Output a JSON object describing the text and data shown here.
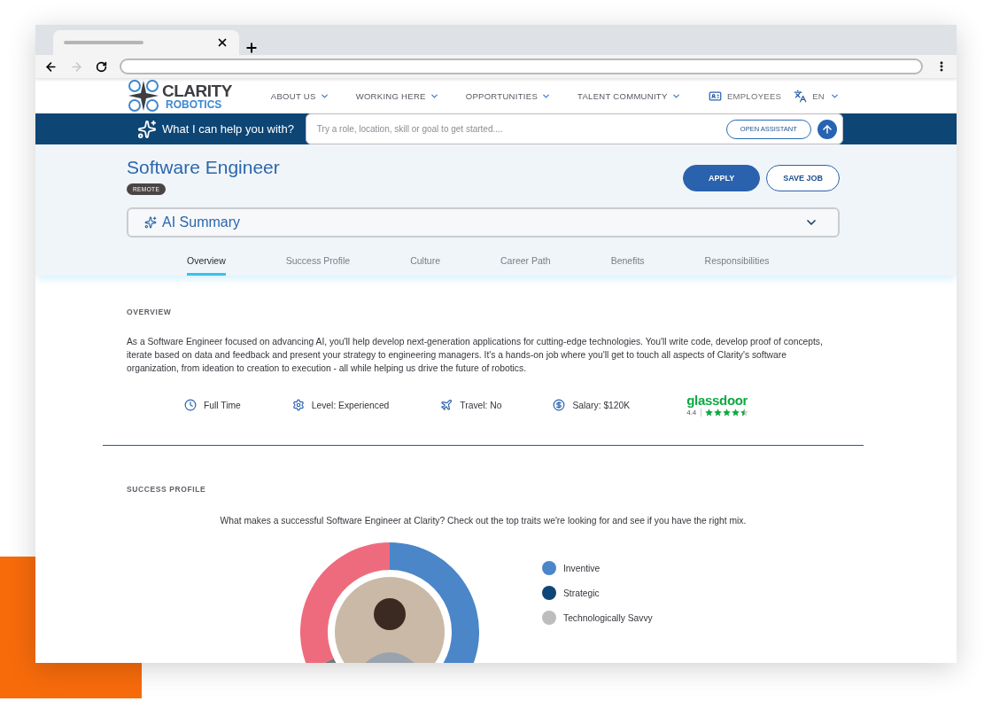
{
  "logo": {
    "line_1": "CLARITY",
    "line_2": "ROBOTICS"
  },
  "nav": [
    {
      "label": "ABOUT US"
    },
    {
      "label": "WORKING HERE"
    },
    {
      "label": "OPPORTUNITIES"
    },
    {
      "label": "TALENT COMMUNITY"
    }
  ],
  "utility": {
    "employees": "EMPLOYEES",
    "language": "EN"
  },
  "assistant": {
    "prompt": "What I can help you with?",
    "placeholder": "Try a role, location, skill or goal to get started....",
    "button": "OPEN ASSISTANT"
  },
  "job": {
    "title": "Software Engineer",
    "badge": "REMOTE",
    "buttons": [
      {
        "label": "APPLY",
        "kind": "primary"
      },
      {
        "label": "SAVE JOB",
        "kind": "secondary"
      }
    ]
  },
  "ai_summary": {
    "label": "AI Summary",
    "expanded": false
  },
  "tabs": [
    {
      "label": "Overview",
      "selected": true
    },
    {
      "label": "Success Profile",
      "selected": false
    },
    {
      "label": "Culture",
      "selected": false
    },
    {
      "label": "Career Path",
      "selected": false
    },
    {
      "label": "Benefits",
      "selected": false
    },
    {
      "label": "Responsibilities",
      "selected": false
    }
  ],
  "overview": {
    "heading": "OVERVIEW",
    "text": "As a Software Engineer focused on advancing AI, you'll help develop next-generation applications for cutting-edge technologies. You'll write code, develop proof of concepts, iterate based on data and feedback and present your strategy to engineering managers. It's a hands-on job where you'll get to touch all aspects of Clarity's software organization, from ideation to creation to execution - all while helping us drive the future of robotics.",
    "facts": [
      {
        "kind": "time",
        "label": "Full Time"
      },
      {
        "kind": "level",
        "label": "Level: Experienced"
      },
      {
        "kind": "travel",
        "label": "Travel: No"
      },
      {
        "kind": "salary",
        "label": "Salary: $120K"
      }
    ],
    "rating": {
      "brand": "glassdoor",
      "score": "4.4",
      "stars": 4.5
    }
  },
  "success_profile": {
    "heading": "SUCCESS PROFILE",
    "intro": "What makes a successful Software Engineer at Clarity? Check out the top traits we're looking for and see if you have the right mix.",
    "traits": [
      {
        "label": "Inventive",
        "color": "#4a86c8"
      },
      {
        "label": "Strategic",
        "color": "#0e4677"
      },
      {
        "label": "Technologically Savvy",
        "color": "#bdbdbd"
      }
    ]
  }
}
